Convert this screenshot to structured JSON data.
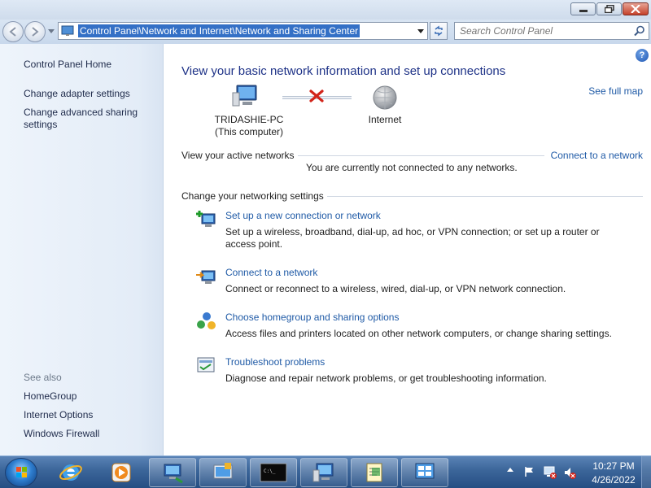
{
  "window": {
    "address": "Control Panel\\Network and Internet\\Network and Sharing Center",
    "search_placeholder": "Search Control Panel"
  },
  "sidebar": {
    "home": "Control Panel Home",
    "items": [
      "Change adapter settings",
      "Change advanced sharing settings"
    ],
    "see_also_title": "See also",
    "see_also": [
      "HomeGroup",
      "Internet Options",
      "Windows Firewall"
    ]
  },
  "main": {
    "title": "View your basic network information and set up connections",
    "see_full_map": "See full map",
    "computer_name": "TRIDASHIE-PC",
    "computer_sub": "(This computer)",
    "internet_label": "Internet",
    "active_networks_title": "View your active networks",
    "connect_link": "Connect to a network",
    "not_connected": "You are currently not connected to any networks.",
    "change_settings_title": "Change your networking settings",
    "tasks": [
      {
        "link": "Set up a new connection or network",
        "desc": "Set up a wireless, broadband, dial-up, ad hoc, or VPN connection; or set up a router or access point.",
        "icon": "new-connection-icon"
      },
      {
        "link": "Connect to a network",
        "desc": "Connect or reconnect to a wireless, wired, dial-up, or VPN network connection.",
        "icon": "connect-network-icon"
      },
      {
        "link": "Choose homegroup and sharing options",
        "desc": "Access files and printers located on other network computers, or change sharing settings.",
        "icon": "homegroup-icon"
      },
      {
        "link": "Troubleshoot problems",
        "desc": "Diagnose and repair network problems, or get troubleshooting information.",
        "icon": "troubleshoot-icon"
      }
    ]
  },
  "taskbar": {
    "time": "10:27 PM",
    "date": "4/26/2022",
    "apps": [
      "internet-explorer-icon",
      "media-player-icon",
      "network-computer-icon",
      "control-panel-icon",
      "command-prompt-icon",
      "computer-icon",
      "notepad-icon",
      "network-center-icon"
    ]
  },
  "colors": {
    "link": "#1f5aa6",
    "title": "#1e3287",
    "address_highlight": "#3470c6",
    "taskbar": "#3b6599"
  }
}
